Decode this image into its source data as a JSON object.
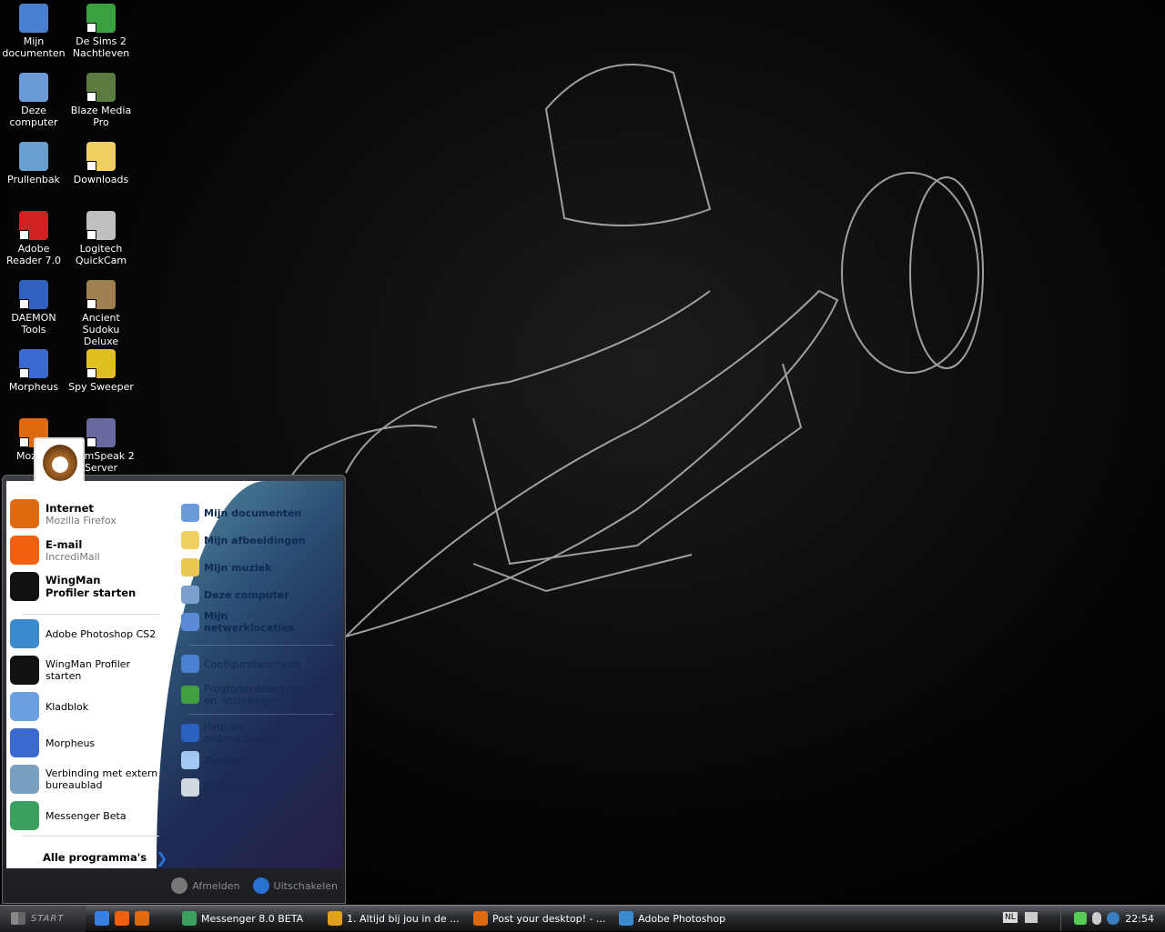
{
  "desktop": {
    "icons": [
      {
        "label": "Mijn documenten",
        "icon": "my-documents-icon",
        "color": "#4a7fd0"
      },
      {
        "label": "De Sims 2 Nachtleven",
        "icon": "sims-icon",
        "color": "#3aa040"
      },
      {
        "label": "Deze computer",
        "icon": "computer-icon",
        "color": "#6a9ad8"
      },
      {
        "label": "Blaze Media Pro",
        "icon": "blaze-media-icon",
        "color": "#5a7a40"
      },
      {
        "label": "Prullenbak",
        "icon": "recycle-bin-icon",
        "color": "#6aa0d0"
      },
      {
        "label": "Downloads",
        "icon": "folder-icon",
        "color": "#f0d060"
      },
      {
        "label": "Adobe Reader 7.0",
        "icon": "adobe-reader-icon",
        "color": "#d02020"
      },
      {
        "label": "Logitech QuickCam",
        "icon": "webcam-icon",
        "color": "#c0c0c0"
      },
      {
        "label": "DAEMON Tools",
        "icon": "daemon-tools-icon",
        "color": "#3060c0"
      },
      {
        "label": "Ancient Sudoku Deluxe",
        "icon": "sudoku-icon",
        "color": "#a08050"
      },
      {
        "label": "Morpheus",
        "icon": "morpheus-icon",
        "color": "#3a6ad0"
      },
      {
        "label": "Spy Sweeper",
        "icon": "spy-sweeper-icon",
        "color": "#e0c020"
      },
      {
        "label": "Mozilla",
        "icon": "firefox-icon",
        "color": "#e06a10"
      },
      {
        "label": "TeamSpeak 2 Server",
        "icon": "teamspeak-icon",
        "color": "#6a6aa0"
      }
    ]
  },
  "start_menu": {
    "pinned": [
      {
        "title": "Internet",
        "subtitle": "Mozilla Firefox",
        "icon": "firefox-icon",
        "color": "#e06a10"
      },
      {
        "title": "E-mail",
        "subtitle": "IncrediMail",
        "icon": "email-icon",
        "color": "#f06010"
      },
      {
        "title": "WingMan Profiler starten",
        "icon": "wingman-icon",
        "color": "#111111"
      }
    ],
    "recent": [
      {
        "label": "Adobe Photoshop CS2",
        "icon": "photoshop-icon",
        "color": "#3a8ad0"
      },
      {
        "label": "WingMan Profiler starten",
        "icon": "wingman-icon",
        "color": "#111111"
      },
      {
        "label": "Kladblok",
        "icon": "notepad-icon",
        "color": "#6aa0e0"
      },
      {
        "label": "Morpheus",
        "icon": "morpheus-icon",
        "color": "#3a6ad0"
      },
      {
        "label": "Verbinding met extern bureaublad",
        "icon": "remote-desktop-icon",
        "color": "#7aa0c0"
      },
      {
        "label": "Messenger Beta",
        "icon": "messenger-icon",
        "color": "#3aa060"
      }
    ],
    "all_programs": "Alle programma's",
    "places": [
      {
        "label": "Mijn documenten",
        "icon": "my-documents-icon",
        "color": "#6a9ad8",
        "bold": true
      },
      {
        "label": "Mijn afbeeldingen",
        "icon": "folder-icon",
        "color": "#f0d060",
        "bold": true
      },
      {
        "label": "Mijn muziek",
        "icon": "music-folder-icon",
        "color": "#e8c850",
        "bold": true
      },
      {
        "label": "Deze computer",
        "icon": "computer-icon",
        "color": "#7aa0d0",
        "bold": true
      },
      {
        "label": "Mijn netwerklocaties",
        "icon": "network-icon",
        "color": "#5a8ad8",
        "bold": true
      }
    ],
    "system": [
      {
        "label": "Configuratiescherm",
        "icon": "control-panel-icon",
        "color": "#4a80d0"
      },
      {
        "label": "Programmatoegang en -instellingen",
        "icon": "program-access-icon",
        "color": "#40a040"
      }
    ],
    "tools": [
      {
        "label": "Help en ondersteuning",
        "icon": "help-icon",
        "color": "#2a60c0"
      },
      {
        "label": "Zoeken",
        "icon": "search-icon",
        "color": "#a0c8f0"
      },
      {
        "label": "Uitvoeren...",
        "icon": "run-icon",
        "color": "#d0d8e0"
      }
    ],
    "logoff": "Afmelden",
    "shutdown": "Uitschakelen"
  },
  "taskbar": {
    "start_label": "Start",
    "quick_launch": [
      {
        "icon": "internet-explorer-icon",
        "color": "#3a80e0"
      },
      {
        "icon": "email-icon",
        "color": "#f06010"
      },
      {
        "icon": "firefox-icon",
        "color": "#e06a10"
      }
    ],
    "tasks": [
      {
        "label": "Messenger 8.0 BETA",
        "icon": "messenger-icon",
        "color": "#3aa060"
      },
      {
        "label": "1. Altijd bij jou in de ...",
        "icon": "media-player-icon",
        "color": "#e0a020"
      },
      {
        "label": "Post your desktop! - ...",
        "icon": "firefox-icon",
        "color": "#e06a10"
      },
      {
        "label": "Adobe Photoshop",
        "icon": "photoshop-icon",
        "color": "#3a8ad0"
      }
    ],
    "language": "NL",
    "clock": "22:54"
  }
}
